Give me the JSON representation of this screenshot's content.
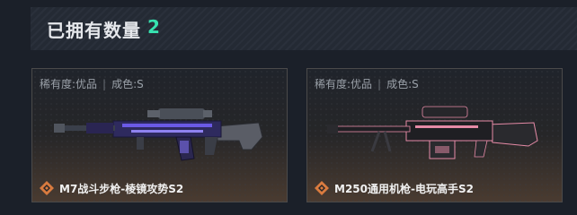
{
  "header": {
    "title": "已拥有数量",
    "count": "2"
  },
  "items": [
    {
      "rarity_label": "稀有度:优品",
      "condition_label": "成色:S",
      "name": "M7战斗步枪-棱镜攻势S2",
      "icon": "weapon-rifle-icon",
      "accent": "#5b4bd1"
    },
    {
      "rarity_label": "稀有度:优品",
      "condition_label": "成色:S",
      "name": "M250通用机枪-电玩高手S2",
      "icon": "weapon-machinegun-icon",
      "accent": "#e58aa6"
    }
  ],
  "colors": {
    "count": "#37e2b0",
    "diamond": "#d97b3f"
  }
}
